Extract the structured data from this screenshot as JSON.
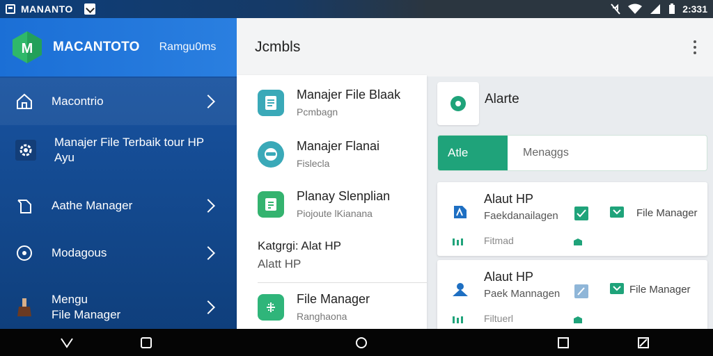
{
  "status_bar": {
    "app_title": "MANANTO",
    "time": "2:331"
  },
  "sidebar": {
    "brand": "MACANTOTO",
    "brand_sub": "Ramgu0ms",
    "items": [
      {
        "label": "Macontrio",
        "icon": "home-icon"
      },
      {
        "label": "Manajer File Terbaik tour HP Ayu",
        "icon": "gear-icon"
      },
      {
        "label": "Aathe Manager",
        "icon": "document-icon"
      },
      {
        "label": "Modagous",
        "icon": "target-icon"
      },
      {
        "label_line1": "Mengu",
        "label_line2": "File Manager",
        "icon": "brush-icon"
      }
    ]
  },
  "main": {
    "title": "Jcmbls"
  },
  "list": {
    "items": [
      {
        "title": "Manajer File Blaak",
        "sub": "Pcmbagn",
        "icon": "document-icon"
      },
      {
        "title": "Manajer Flanai",
        "sub": "Fislecla",
        "icon": "bot-icon"
      },
      {
        "title": "Planay Slenplian",
        "sub": "Piojoute lKianana",
        "icon": "clipboard-icon"
      }
    ],
    "category_title": "Katgrgi: Alat HP",
    "category_sub": "Alatt HP",
    "last_item": {
      "title": "File Manager",
      "sub": "Ranghaona",
      "icon": "grid-icon"
    }
  },
  "right": {
    "alert_title": "Alarte",
    "tab_active": "Atle",
    "tab_inactive": "Menaggs",
    "cards": [
      {
        "title": "Alaut HP",
        "sub": "Faekdanailagen",
        "fm_label": "File Manager",
        "foot_label": "Fitmad"
      },
      {
        "title": "Alaut HP",
        "sub": "Paek Mannagen",
        "fm_label": "File Manager",
        "foot_label": "Filtuerl"
      }
    ]
  },
  "colors": {
    "accent_green": "#1fa37a",
    "sidebar_blue": "#1a56a8",
    "icon_teal": "#3aa9b8"
  }
}
